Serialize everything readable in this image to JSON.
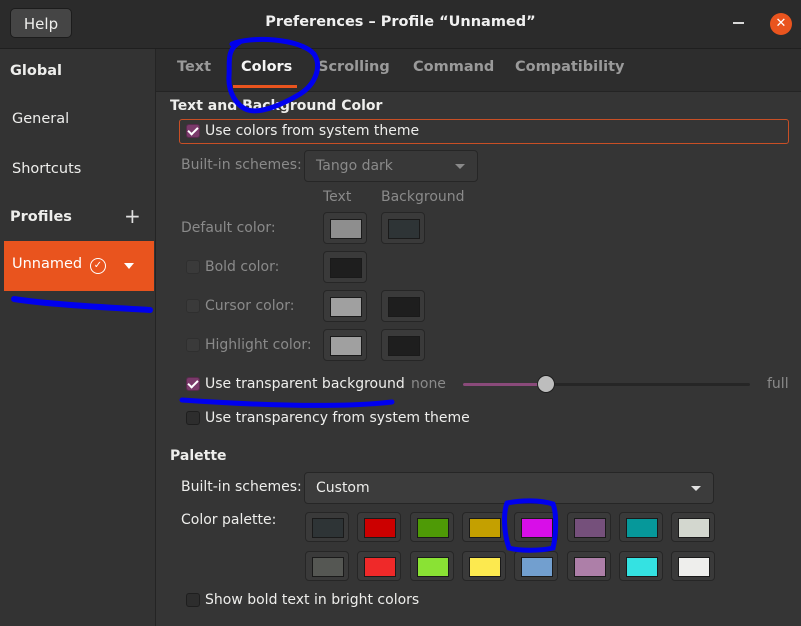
{
  "window": {
    "help_label": "Help",
    "title": "Preferences – Profile “Unnamed”",
    "close_glyph": "✕"
  },
  "sidebar": {
    "global_label": "Global",
    "general_label": "General",
    "shortcuts_label": "Shortcuts",
    "profiles_label": "Profiles",
    "add_glyph": "+",
    "profile_name": "Unnamed",
    "profile_check_glyph": "✓"
  },
  "tabs": [
    "Text",
    "Colors",
    "Scrolling",
    "Command",
    "Compatibility"
  ],
  "active_tab": "Colors",
  "text_bg": {
    "section_title": "Text and Background Color",
    "use_system_label": "Use colors from system theme",
    "use_system_checked": true,
    "builtin_label": "Built-in schemes:",
    "builtin_value": "Tango dark",
    "col_text": "Text",
    "col_background": "Background",
    "default_label": "Default color:",
    "bold_label": "Bold color:",
    "cursor_label": "Cursor color:",
    "highlight_label": "Highlight color:",
    "default_text_color": "#8e8e8e",
    "default_bg_color": "#2e3436",
    "bold_color": "#1e1e1e",
    "cursor_text_color": "#a0a0a0",
    "cursor_bg_color": "#1e1e1e",
    "highlight_text_color": "#a0a0a0",
    "highlight_bg_color": "#1e1e1e",
    "transparent_label": "Use transparent background",
    "transparent_checked": true,
    "transparency_none": "none",
    "transparency_full": "full",
    "transparency_level": 0.29,
    "transparency_system_label": "Use transparency from system theme"
  },
  "palette": {
    "section_title": "Palette",
    "builtin_label": "Built-in schemes:",
    "builtin_value": "Custom",
    "color_palette_label": "Color palette:",
    "row1": [
      "#2e3436",
      "#cc0000",
      "#4e9a06",
      "#c4a000",
      "#d80ee8",
      "#75507b",
      "#06989a",
      "#d3d7cf"
    ],
    "row2": [
      "#555753",
      "#ef2929",
      "#8ae234",
      "#fce94f",
      "#729fcf",
      "#ad7fa8",
      "#34e2e2",
      "#eeeeec"
    ],
    "bright_bold_label": "Show bold text in bright colors"
  },
  "colors": {
    "accent": "#e9541e",
    "annotation": "#0000ee"
  }
}
